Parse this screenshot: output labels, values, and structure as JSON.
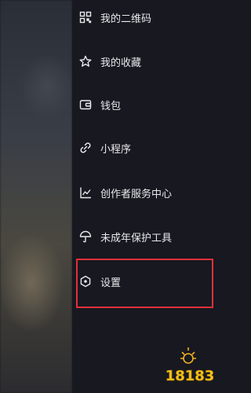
{
  "menu": {
    "items": [
      {
        "label": "我的二维码",
        "icon": "qr-code-icon"
      },
      {
        "label": "我的收藏",
        "icon": "star-icon"
      },
      {
        "label": "钱包",
        "icon": "wallet-icon"
      },
      {
        "label": "小程序",
        "icon": "link-icon"
      },
      {
        "label": "创作者服务中心",
        "icon": "chart-line-icon"
      },
      {
        "label": "未成年保护工具",
        "icon": "umbrella-icon"
      },
      {
        "label": "设置",
        "icon": "settings-hexagon-icon"
      }
    ]
  },
  "watermark": {
    "text": "18183"
  },
  "colors": {
    "highlight": "#e0303a",
    "drawer_bg": "#181820",
    "text": "#e8e8ec"
  }
}
